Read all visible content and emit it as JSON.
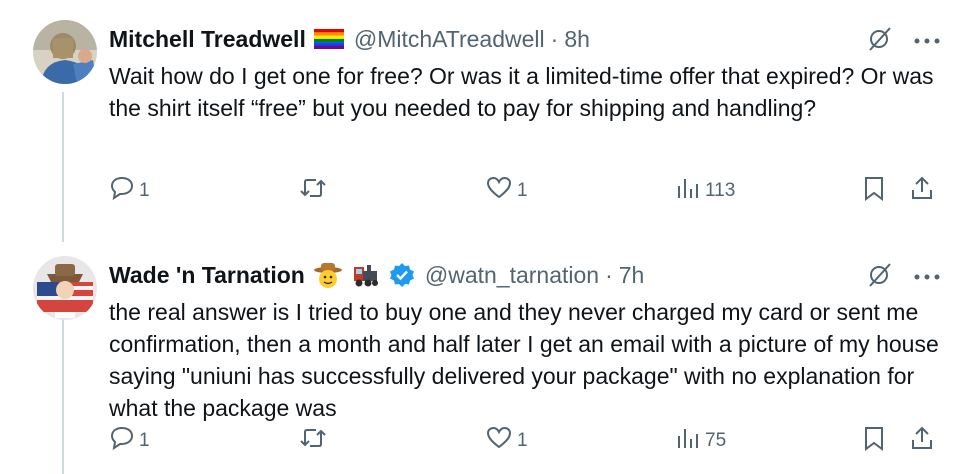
{
  "tweets": [
    {
      "name": "Mitchell Treadwell",
      "badge_icon": "rainbow-flag-icon",
      "handle": "@MitchATreadwell",
      "separator": "·",
      "time": "8h",
      "text": "Wait how do I get one for free? Or was it a limited-time offer that expired? Or was the shirt itself “free” but you needed to pay for shipping and handling?",
      "replies": "1",
      "retweets": "",
      "likes": "1",
      "views": "113"
    },
    {
      "name": "Wade 'n Tarnation",
      "badge_icons": [
        "cowboy-emoji-icon",
        "train-emoji-icon",
        "verified-badge-icon"
      ],
      "handle": "@watn_tarnation",
      "separator": "·",
      "time": "7h",
      "text": "the real answer is I tried to buy one and they never charged my card or sent me confirmation, then a month and half later I get an email with a picture of my house saying \"uniuni has successfully delivered your package\" with no explanation for what the package was",
      "replies": "1",
      "retweets": "",
      "likes": "1",
      "views": "75"
    }
  ],
  "colors": {
    "text": "#0f1419",
    "secondary": "#536471",
    "thread": "#cfd9de",
    "verified": "#1d9bf0"
  }
}
